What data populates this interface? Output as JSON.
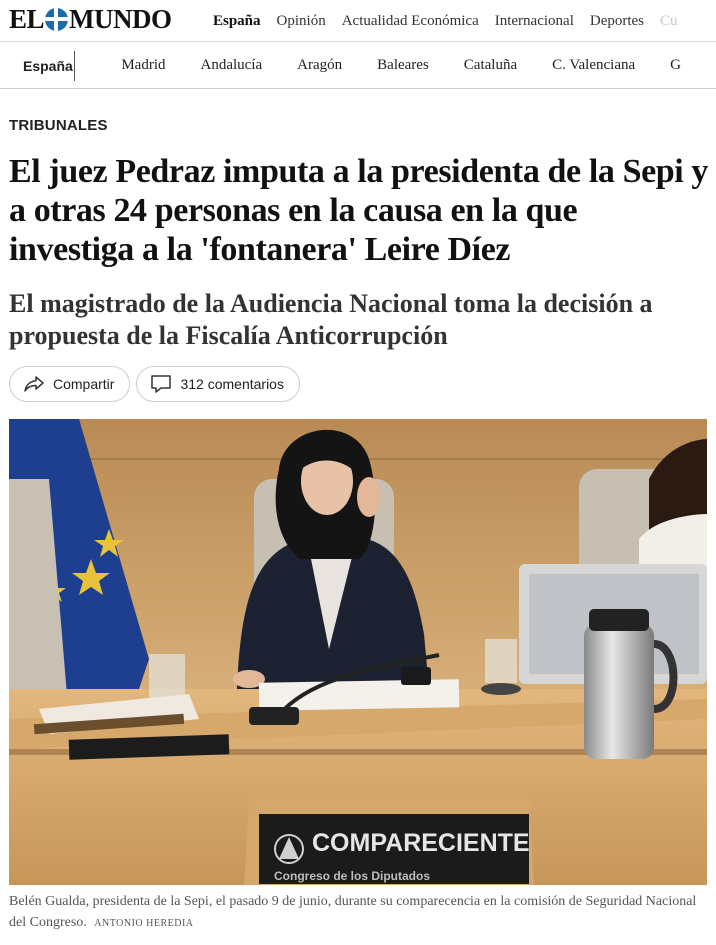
{
  "header": {
    "logo": {
      "left": "EL",
      "right": "MUNDO"
    },
    "nav": [
      {
        "label": "España",
        "active": true
      },
      {
        "label": "Opinión"
      },
      {
        "label": "Actualidad Económica"
      },
      {
        "label": "Internacional"
      },
      {
        "label": "Deportes"
      },
      {
        "label": "Cu",
        "faded": true
      }
    ]
  },
  "subnav": {
    "section": "España",
    "regions": [
      "Madrid",
      "Andalucía",
      "Aragón",
      "Baleares",
      "Cataluña",
      "C. Valenciana",
      "G"
    ]
  },
  "article": {
    "kicker": "TRIBUNALES",
    "headline": "El juez Pedraz imputa a la presidenta de la Sepi y a otras 24 personas en la causa en la que investiga a la 'fontanera' Leire Díez",
    "subheadline": "El magistrado de la Audiencia Nacional toma la decisión a propuesta de la Fiscalía Anticorrupción",
    "share_label": "Compartir",
    "comments_label": "312 comentarios",
    "photo": {
      "nameplate": "COMPARECIENTE",
      "nameplate_sub": "Congreso de los Diputados"
    },
    "caption": "Belén Gualda, presidenta de la Sepi, el pasado 9 de junio, durante su comparecencia en la comisión de Seguridad Nacional del Congreso.",
    "credit": "Antonio Heredia"
  },
  "colors": {
    "logo_globe": "#1b6ca8",
    "border": "#d9d9d9",
    "text": "#111111",
    "caption": "#555555"
  }
}
